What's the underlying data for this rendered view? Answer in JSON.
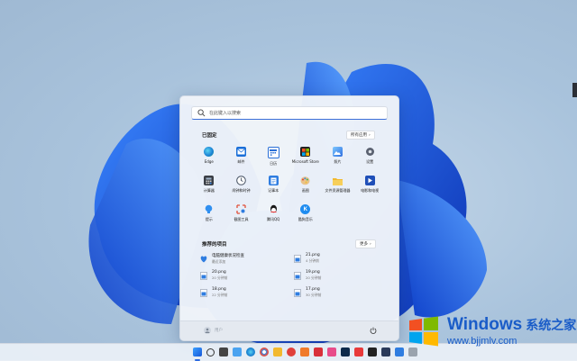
{
  "search": {
    "placeholder": "在此键入以搜索"
  },
  "pinned": {
    "title": "已固定",
    "all_label": "所有应用",
    "apps": [
      {
        "label": "Edge",
        "icon": "edge-icon"
      },
      {
        "label": "邮件",
        "icon": "mail-icon"
      },
      {
        "label": "日历",
        "icon": "calendar-icon"
      },
      {
        "label": "Microsoft Store",
        "icon": "store-icon"
      },
      {
        "label": "照片",
        "icon": "photos-icon"
      },
      {
        "label": "设置",
        "icon": "settings-icon"
      },
      {
        "label": "计算器",
        "icon": "calculator-icon"
      },
      {
        "label": "闹钟和时钟",
        "icon": "clock-icon"
      },
      {
        "label": "记事本",
        "icon": "notepad-icon"
      },
      {
        "label": "画图",
        "icon": "paint-icon"
      },
      {
        "label": "文件资源管理器",
        "icon": "folder-icon"
      },
      {
        "label": "电影和电视",
        "icon": "movies-icon"
      },
      {
        "label": "提示",
        "icon": "tips-icon"
      },
      {
        "label": "截图工具",
        "icon": "snipping-icon"
      },
      {
        "label": "腾讯QQ",
        "icon": "qq-icon"
      },
      {
        "label": "酷狗音乐",
        "icon": "kugou-icon"
      }
    ]
  },
  "recommended": {
    "title": "推荐的项目",
    "more_label": "更多",
    "items": [
      {
        "name": "电脑健康状况检查",
        "detail": "最近添加"
      },
      {
        "name": "21.png",
        "detail": "4 分钟前"
      },
      {
        "name": "20.png",
        "detail": "20 分钟前"
      },
      {
        "name": "19.png",
        "detail": "20 分钟前"
      },
      {
        "name": "18.png",
        "detail": "22 分钟前"
      },
      {
        "name": "17.png",
        "detail": "30 分钟前"
      }
    ]
  },
  "user": {
    "name": "用户"
  },
  "watermark": {
    "brand": "Windows",
    "cn": "系统之家",
    "url": "www.bjjmlv.com"
  },
  "colors": {
    "accent": "#1a5cc8",
    "wallpaper_blue": "#1f5fe0"
  }
}
